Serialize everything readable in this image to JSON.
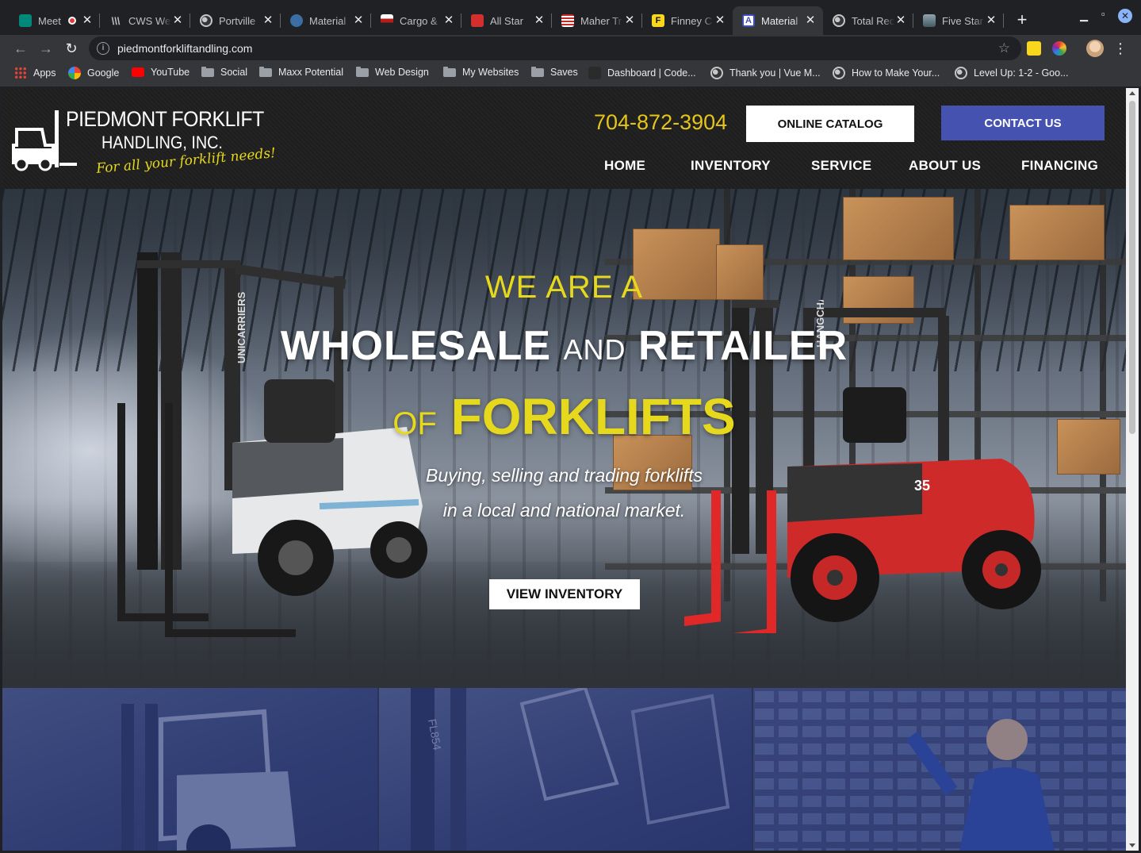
{
  "browser": {
    "tabs": [
      {
        "title": "Meet",
        "favicon_color": "#00897b",
        "recording": true,
        "active": false
      },
      {
        "title": "CWS Web",
        "favicon_color": "#5f6368",
        "active": false
      },
      {
        "title": "Portville",
        "favicon_color": "#9aa0a6",
        "active": false
      },
      {
        "title": "Material",
        "favicon_color": "#3a6ea5",
        "active": false
      },
      {
        "title": "Cargo &",
        "favicon_color": "#b71c1c",
        "active": false
      },
      {
        "title": "All Star",
        "favicon_color": "#d32f2f",
        "active": false
      },
      {
        "title": "Maher Tr",
        "favicon_color": "#1a237e",
        "active": false
      },
      {
        "title": "Finney C",
        "favicon_color": "#f9d71c",
        "active": false
      },
      {
        "title": "Material",
        "favicon_color": "#3f51b5",
        "active": true
      },
      {
        "title": "Total Rec",
        "favicon_color": "#9aa0a6",
        "active": false
      },
      {
        "title": "Five Star",
        "favicon_color": "#607d8b",
        "active": false
      }
    ],
    "url": "piedmontforkliftandling.com",
    "bookmarks": [
      {
        "label": "Apps",
        "icon": "apps-grid-icon"
      },
      {
        "label": "Google",
        "icon": "google-icon"
      },
      {
        "label": "YouTube",
        "icon": "youtube-icon"
      },
      {
        "label": "Social",
        "icon": "folder-icon"
      },
      {
        "label": "Maxx Potential",
        "icon": "folder-icon"
      },
      {
        "label": "Web Design",
        "icon": "folder-icon"
      },
      {
        "label": "My Websites",
        "icon": "folder-icon"
      },
      {
        "label": "Saves",
        "icon": "folder-icon"
      },
      {
        "label": "Dashboard | Code...",
        "icon": "codepen-icon"
      },
      {
        "label": "Thank you | Vue M...",
        "icon": "globe-icon"
      },
      {
        "label": "How to Make Your...",
        "icon": "globe-icon"
      },
      {
        "label": "Level Up: 1-2 - Goo...",
        "icon": "globe-icon"
      }
    ]
  },
  "site": {
    "logo": {
      "title": "PIEDMONT FORKLIFT",
      "subtitle": "HANDLING, INC.",
      "tagline": "For all your forklift needs!"
    },
    "phone": "704-872-3904",
    "catalog_button": "ONLINE CATALOG",
    "contact_button": "CONTACT US",
    "nav": [
      "HOME",
      "INVENTORY",
      "SERVICE",
      "ABOUT US",
      "FINANCING"
    ],
    "hero": {
      "line1": "WE ARE A",
      "wholesale": "WHOLESALE",
      "and": "AND",
      "retailer": "RETAILER",
      "of": "OF",
      "forklifts": "FORKLIFTS",
      "tagline1": "Buying, selling and trading forklifts",
      "tagline2": "in a local and national market.",
      "button": "VIEW INVENTORY",
      "white_forklift_brand": "UNICARRIERS",
      "red_forklift_brand": "HANGCHA",
      "red_forklift_number": "35"
    },
    "colors": {
      "accent_yellow": "#e6d81c",
      "contact_blue": "#4552b0"
    }
  }
}
